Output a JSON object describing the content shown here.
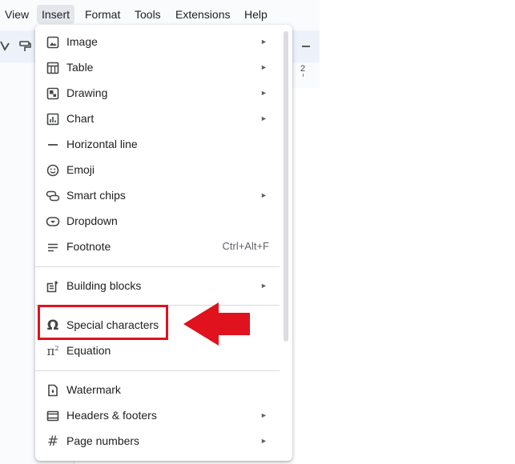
{
  "menubar": {
    "items": [
      {
        "label": "View"
      },
      {
        "label": "Insert"
      },
      {
        "label": "Format"
      },
      {
        "label": "Tools"
      },
      {
        "label": "Extensions"
      },
      {
        "label": "Help"
      }
    ],
    "active": "Insert"
  },
  "ruler": {
    "tick_label": "2"
  },
  "insert_menu": {
    "items": [
      {
        "label": "Image",
        "icon": "image-icon",
        "submenu": true
      },
      {
        "label": "Table",
        "icon": "table-icon",
        "submenu": true
      },
      {
        "label": "Drawing",
        "icon": "drawing-icon",
        "submenu": true
      },
      {
        "label": "Chart",
        "icon": "chart-icon",
        "submenu": true
      },
      {
        "label": "Horizontal line",
        "icon": "horizontal-line-icon",
        "submenu": false
      },
      {
        "label": "Emoji",
        "icon": "emoji-icon",
        "submenu": false
      },
      {
        "label": "Smart chips",
        "icon": "smart-chips-icon",
        "submenu": true
      },
      {
        "label": "Dropdown",
        "icon": "dropdown-icon",
        "submenu": false
      },
      {
        "label": "Footnote",
        "icon": "footnote-icon",
        "submenu": false,
        "shortcut": "Ctrl+Alt+F"
      },
      {
        "label": "Building blocks",
        "icon": "building-blocks-icon",
        "submenu": true
      },
      {
        "label": "Special characters",
        "icon": "omega-icon",
        "submenu": false
      },
      {
        "label": "Equation",
        "icon": "pi-icon",
        "submenu": false
      },
      {
        "label": "Watermark",
        "icon": "watermark-icon",
        "submenu": false
      },
      {
        "label": "Headers & footers",
        "icon": "headers-footers-icon",
        "submenu": true
      },
      {
        "label": "Page numbers",
        "icon": "hash-icon",
        "submenu": true
      }
    ],
    "submenu_arrow": "►"
  },
  "annotation": {
    "highlight_color": "#e0121d"
  }
}
